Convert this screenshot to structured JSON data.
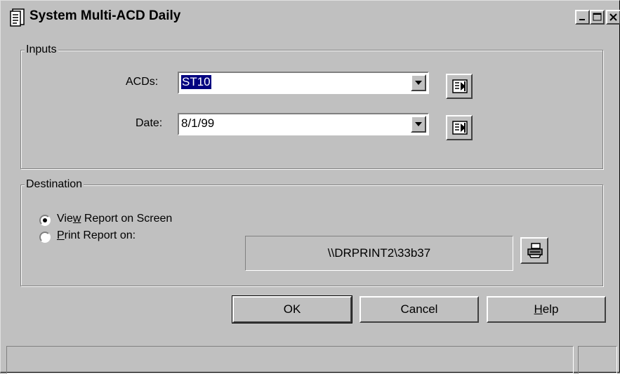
{
  "window": {
    "title": "System Multi-ACD Daily",
    "controls": {
      "minimize": "minimize",
      "maximize": "maximize",
      "close": "close"
    }
  },
  "inputs": {
    "group_label": "Inputs",
    "acds": {
      "label": "ACDs:",
      "value": "ST10",
      "icon": "select-list-icon"
    },
    "date": {
      "label": "Date:",
      "value": "8/1/99",
      "icon": "select-list-icon"
    }
  },
  "destination": {
    "group_label": "Destination",
    "options": [
      {
        "label_before": "Vie",
        "accel": "w",
        "label_after": " Report on Screen",
        "selected": true
      },
      {
        "label_before": "",
        "accel": "P",
        "label_after": "rint Report on:",
        "selected": false
      }
    ],
    "printer": "\\\\DRPRINT2\\33b37",
    "printer_icon": "printer-icon"
  },
  "buttons": {
    "ok": "OK",
    "cancel": "Cancel",
    "help_accel": "H",
    "help_rest": "elp"
  },
  "colors": {
    "face": "#c0c0c0",
    "selection": "#000080"
  }
}
